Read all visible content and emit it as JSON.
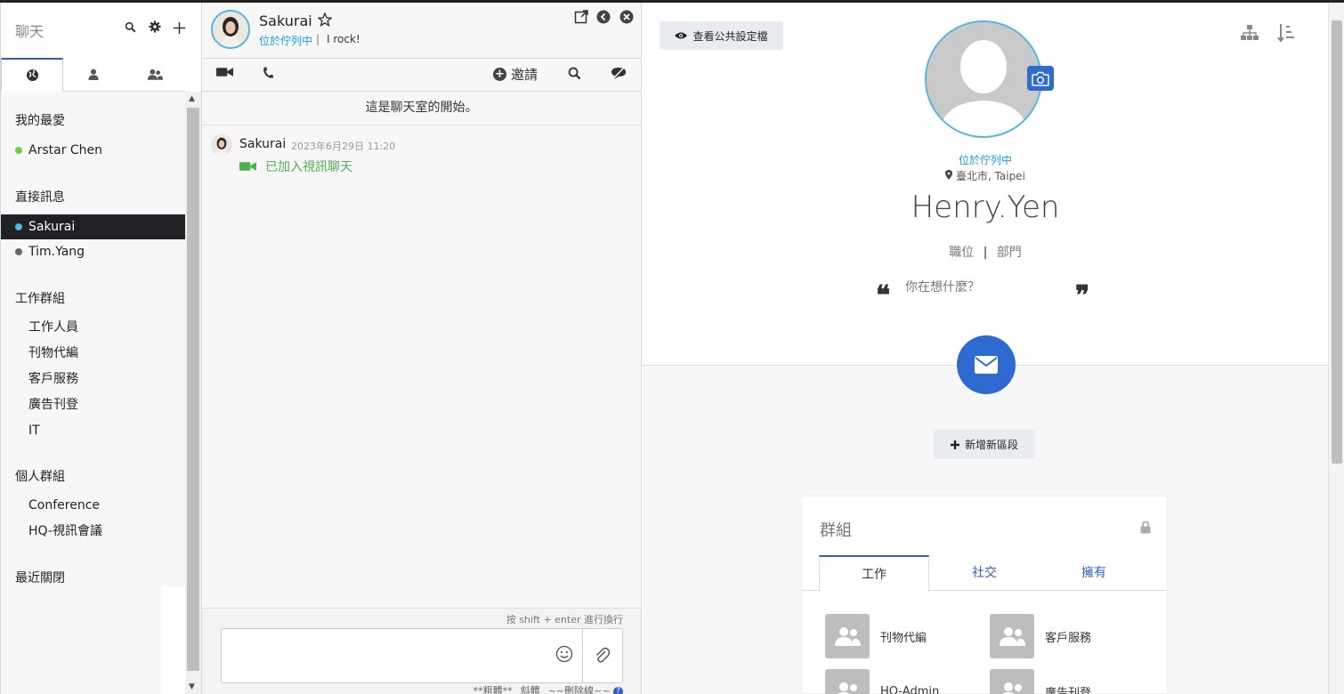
{
  "sidebar": {
    "title": "聊天",
    "tabs": [
      {
        "icon": "globe-icon",
        "active": true
      },
      {
        "icon": "user-icon",
        "active": false
      },
      {
        "icon": "users-icon",
        "active": false
      }
    ],
    "sections": {
      "favorites": "我的最愛",
      "direct": "直接訊息",
      "work_groups": "工作群組",
      "personal_groups": "個人群組",
      "recently_closed": "最近關閉"
    },
    "favorites": [
      {
        "label": "Arstar Chen",
        "status_color": "#7ac943"
      }
    ],
    "direct": [
      {
        "label": "Sakurai",
        "status_color": "#4db6e8",
        "selected": true
      },
      {
        "label": "Tim.Yang",
        "status_color": "#666666",
        "selected": false
      }
    ],
    "work_groups": [
      "工作人員",
      "刊物代編",
      "客戶服務",
      "廣告刊登",
      "IT"
    ],
    "personal_groups": [
      "Conference",
      "HQ-視訊會議"
    ]
  },
  "chat": {
    "name": "Sakurai",
    "status": "位於佇列中",
    "separator": "|",
    "mood": "I rock!",
    "invite_label": "邀請",
    "begin_notice": "這是聊天室的開始。",
    "message": {
      "sender": "Sakurai",
      "time": "2023年6月29日 11:20",
      "text": "已加入視訊聊天"
    },
    "input_hint": "按 shift + enter 進行換行",
    "format_hint": "**粗體** _斜體_ ~~刪除線~~",
    "help_mark": "?"
  },
  "profile": {
    "view_public_label": "查看公共設定檔",
    "status": "位於佇列中",
    "location": "臺北市, Taipei",
    "name": "Henry.Yen",
    "role": "職位",
    "role_sep": "|",
    "department": "部門",
    "mind_placeholder": "你在想什麼？",
    "quote_open": "❝",
    "quote_close": "❞",
    "add_section_label": "新增新區段",
    "groups": {
      "title": "群組",
      "tabs": [
        {
          "label": "工作",
          "active": true
        },
        {
          "label": "社交",
          "active": false
        },
        {
          "label": "擁有",
          "active": false
        }
      ],
      "items": [
        "刊物代編",
        "客戶服務",
        "HQ-Admin",
        "廣告刊登"
      ]
    }
  },
  "colors": {
    "accent": "#2f6ad1",
    "online": "#7ac943",
    "status_blue": "#1a9fe0",
    "video_green": "#4caf50"
  }
}
